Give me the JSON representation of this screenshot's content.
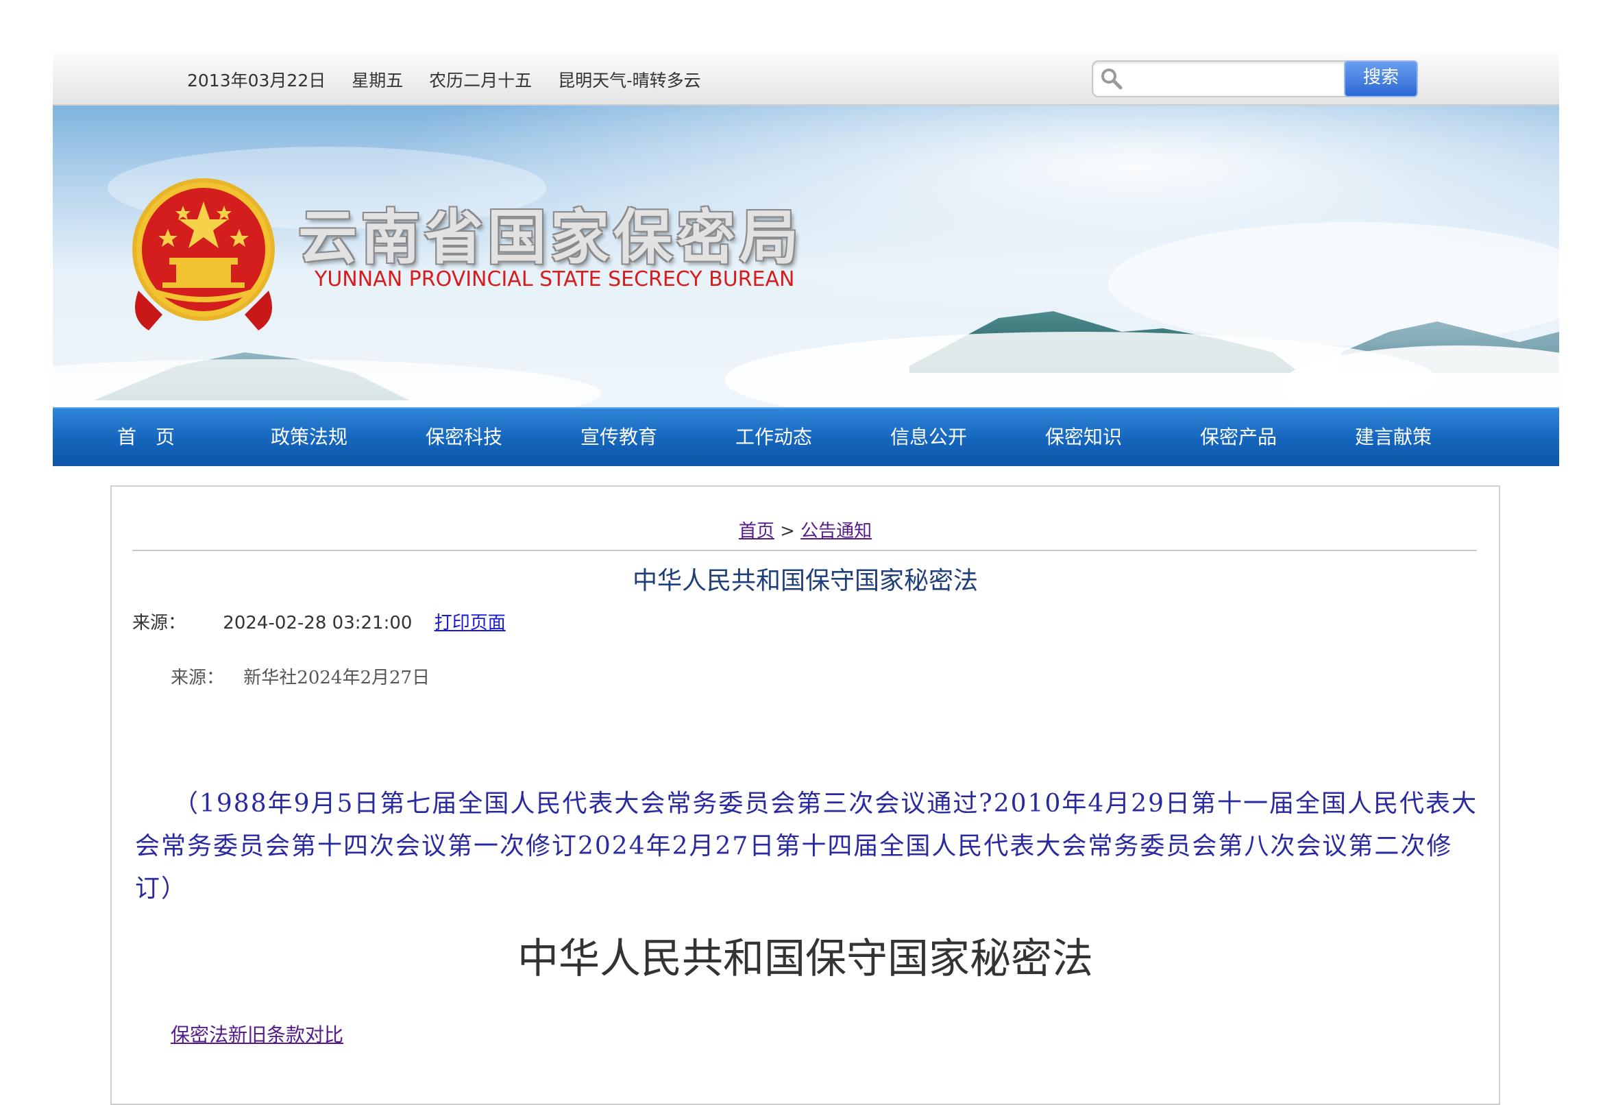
{
  "topbar": {
    "date": "2013年03月22日",
    "weekday": "星期五",
    "lunar": "农历二月十五",
    "weather": "昆明天气-晴转多云",
    "search_placeholder": "",
    "search_button": "搜索"
  },
  "banner": {
    "title": "云南省国家保密局",
    "subtitle": "YUNNAN PROVINCIAL STATE SECRECY BUREAN",
    "emblem_icon": "national-emblem-icon",
    "colors": {
      "emblem_red": "#d41e1e",
      "emblem_gold": "#f2c230",
      "subtitle_red": "#d81c1c"
    }
  },
  "nav": {
    "items": [
      {
        "label": "首　页"
      },
      {
        "label": "政策法规"
      },
      {
        "label": "保密科技"
      },
      {
        "label": "宣传教育"
      },
      {
        "label": "工作动态"
      },
      {
        "label": "信息公开"
      },
      {
        "label": "保密知识"
      },
      {
        "label": "保密产品"
      },
      {
        "label": "建言献策"
      }
    ],
    "color": "#1565bd"
  },
  "article": {
    "breadcrumb": {
      "home": "首页",
      "separator": ">",
      "section": "公告通知"
    },
    "title": "中华人民共和国保守国家秘密法",
    "meta_label": "来源：",
    "meta_time": "2024-02-28 03:21:00",
    "print_link": "打印页面",
    "source_label": "来源：",
    "source_value": "新华社2024年2月27日",
    "preface": "（1988年9月5日第七届全国人民代表大会常务委员会第三次会议通过?2010年4月29日第十一届全国人民代表大会常务委员会第十四次会议第一次修订2024年2月27日第十四届全国人民代表大会常务委员会第八次会议第二次修订）",
    "heading": "中华人民共和国保守国家秘密法",
    "compare_link": "保密法新旧条款对比"
  }
}
